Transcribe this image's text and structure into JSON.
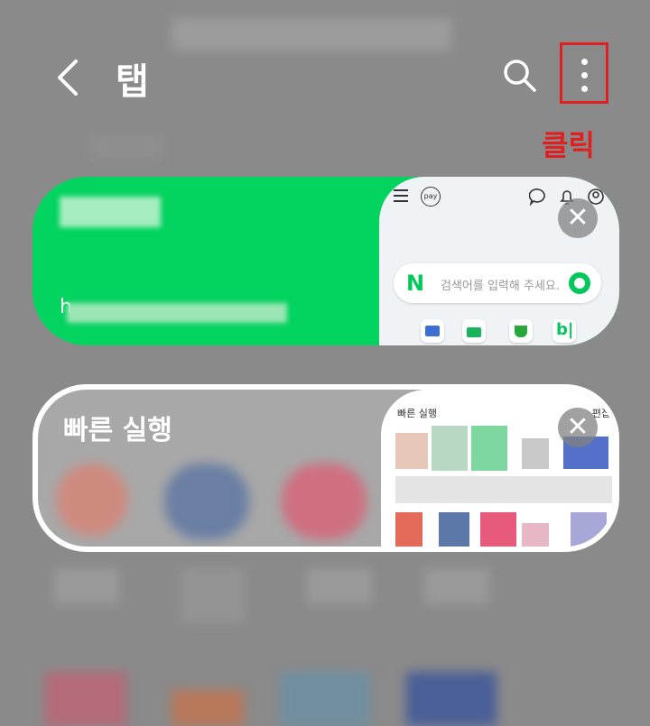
{
  "header": {
    "title": "탭",
    "click_annotation": "클릭"
  },
  "tabs": [
    {
      "site_url_prefix": "h",
      "search_placeholder": "검색어를 입력해 주세요.",
      "pay_label": "pay",
      "brand_color": "#03c75a"
    },
    {
      "title": "빠른 실행",
      "preview_title": "빠른 실행",
      "preview_edit": "편집"
    }
  ],
  "colors": {
    "annotation": "#e02020",
    "tab1_bg": "#03d35f"
  }
}
